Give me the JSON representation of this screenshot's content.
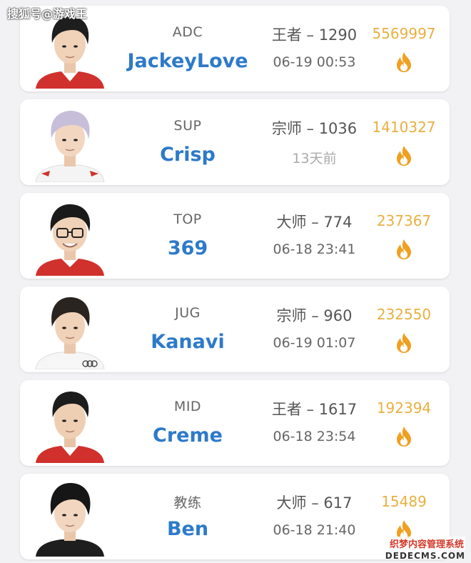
{
  "watermarks": {
    "source": "搜狐号@游戏王",
    "site": "织梦内容管理系统",
    "site_url": "DEDECMS.COM"
  },
  "colors": {
    "name": "#2d7ac9",
    "heat": "#e8b040",
    "fire": "#f0a020"
  },
  "players": [
    {
      "role": "ADC",
      "name": "JackeyLove",
      "rank": "王者 – 1290",
      "time": "06-19 00:53",
      "heat": "5569997",
      "icon": "fire-icon"
    },
    {
      "role": "SUP",
      "name": "Crisp",
      "rank": "宗师 – 1036",
      "time": "13天前",
      "heat": "1410327",
      "icon": "fire-icon"
    },
    {
      "role": "TOP",
      "name": "369",
      "rank": "大师 – 774",
      "time": "06-18 23:41",
      "heat": "237367",
      "icon": "fire-icon"
    },
    {
      "role": "JUG",
      "name": "Kanavi",
      "rank": "宗师 – 960",
      "time": "06-19 01:07",
      "heat": "232550",
      "icon": "fire-icon"
    },
    {
      "role": "MID",
      "name": "Creme",
      "rank": "王者 – 1617",
      "time": "06-18 23:54",
      "heat": "192394",
      "icon": "fire-icon"
    },
    {
      "role": "教练",
      "name": "Ben",
      "rank": "大师 – 617",
      "time": "06-18 21:40",
      "heat": "15489",
      "icon": "fire-icon"
    }
  ]
}
